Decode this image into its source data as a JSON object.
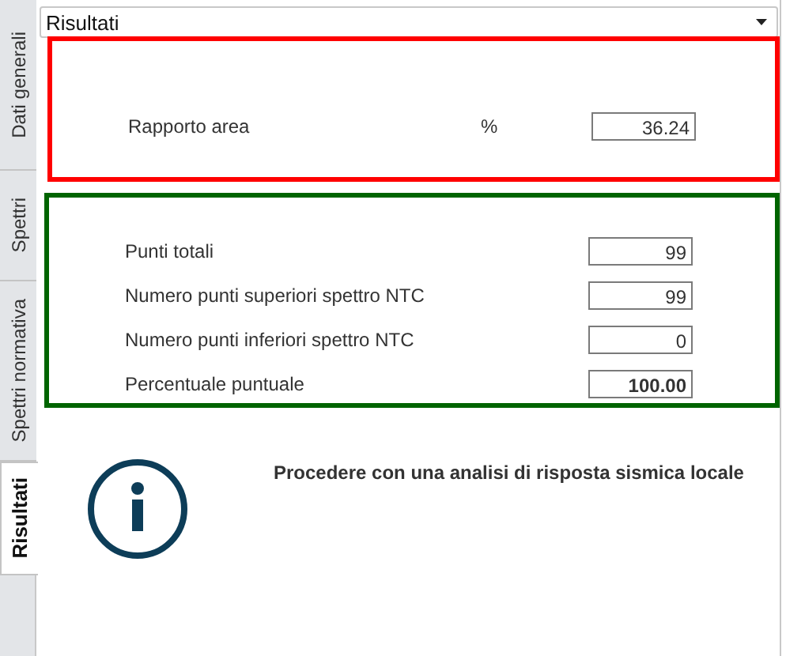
{
  "tabs": [
    {
      "label": "Dati generali",
      "selected": false
    },
    {
      "label": "Spettri",
      "selected": false
    },
    {
      "label": "Spettri normativa",
      "selected": false
    },
    {
      "label": "Risultati",
      "selected": true
    }
  ],
  "selector": {
    "value": "Risultati"
  },
  "area_section": {
    "color": "#ff0000",
    "rows": [
      {
        "label": "Rapporto area",
        "unit": "%",
        "value": "36.24",
        "bold": false
      }
    ]
  },
  "points_section": {
    "color": "#006400",
    "rows": [
      {
        "label": "Punti totali",
        "value": "99",
        "bold": false
      },
      {
        "label": "Numero punti superiori spettro NTC",
        "value": "99",
        "bold": false
      },
      {
        "label": "Numero punti inferiori spettro NTC",
        "value": "0",
        "bold": false
      },
      {
        "label": "Percentuale puntuale",
        "value": "100.00",
        "bold": true
      }
    ]
  },
  "message": {
    "text": "Procedere con una analisi di risposta sismica locale"
  }
}
